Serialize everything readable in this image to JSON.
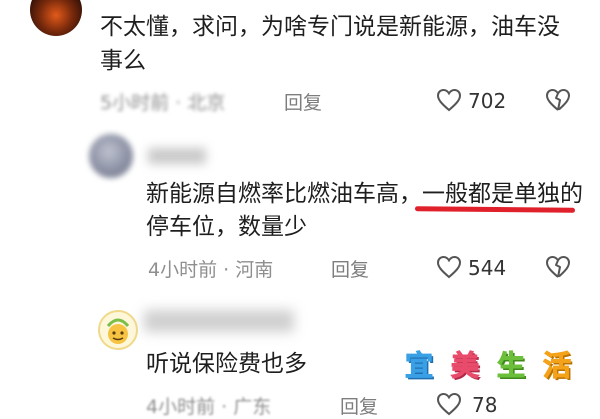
{
  "comments": [
    {
      "text": "不太懂，求问，为啥专门说是新能源，油车没事么",
      "meta": "5小时前 · 北京",
      "reply_label": "回复",
      "likes": "702"
    },
    {
      "text_part1": "新能源自燃率比燃油车高",
      "text_part2": "，一般都是单独的停车位，数量少",
      "meta": "4小时前 · 河南",
      "reply_label": "回复",
      "likes": "544"
    },
    {
      "text": "听说保险费也多",
      "meta": "4小时前 · 广东",
      "reply_label": "回复",
      "likes": "78"
    }
  ],
  "watermark": {
    "chars": [
      "宜",
      "美",
      "生",
      "活"
    ],
    "colors": [
      "#3aa0e6",
      "#e94b6b",
      "#6bbf3a",
      "#f3a21a"
    ]
  },
  "colors": {
    "underline": "#e0202a",
    "meta": "#8f8f8f",
    "text": "#1e1e1e"
  }
}
